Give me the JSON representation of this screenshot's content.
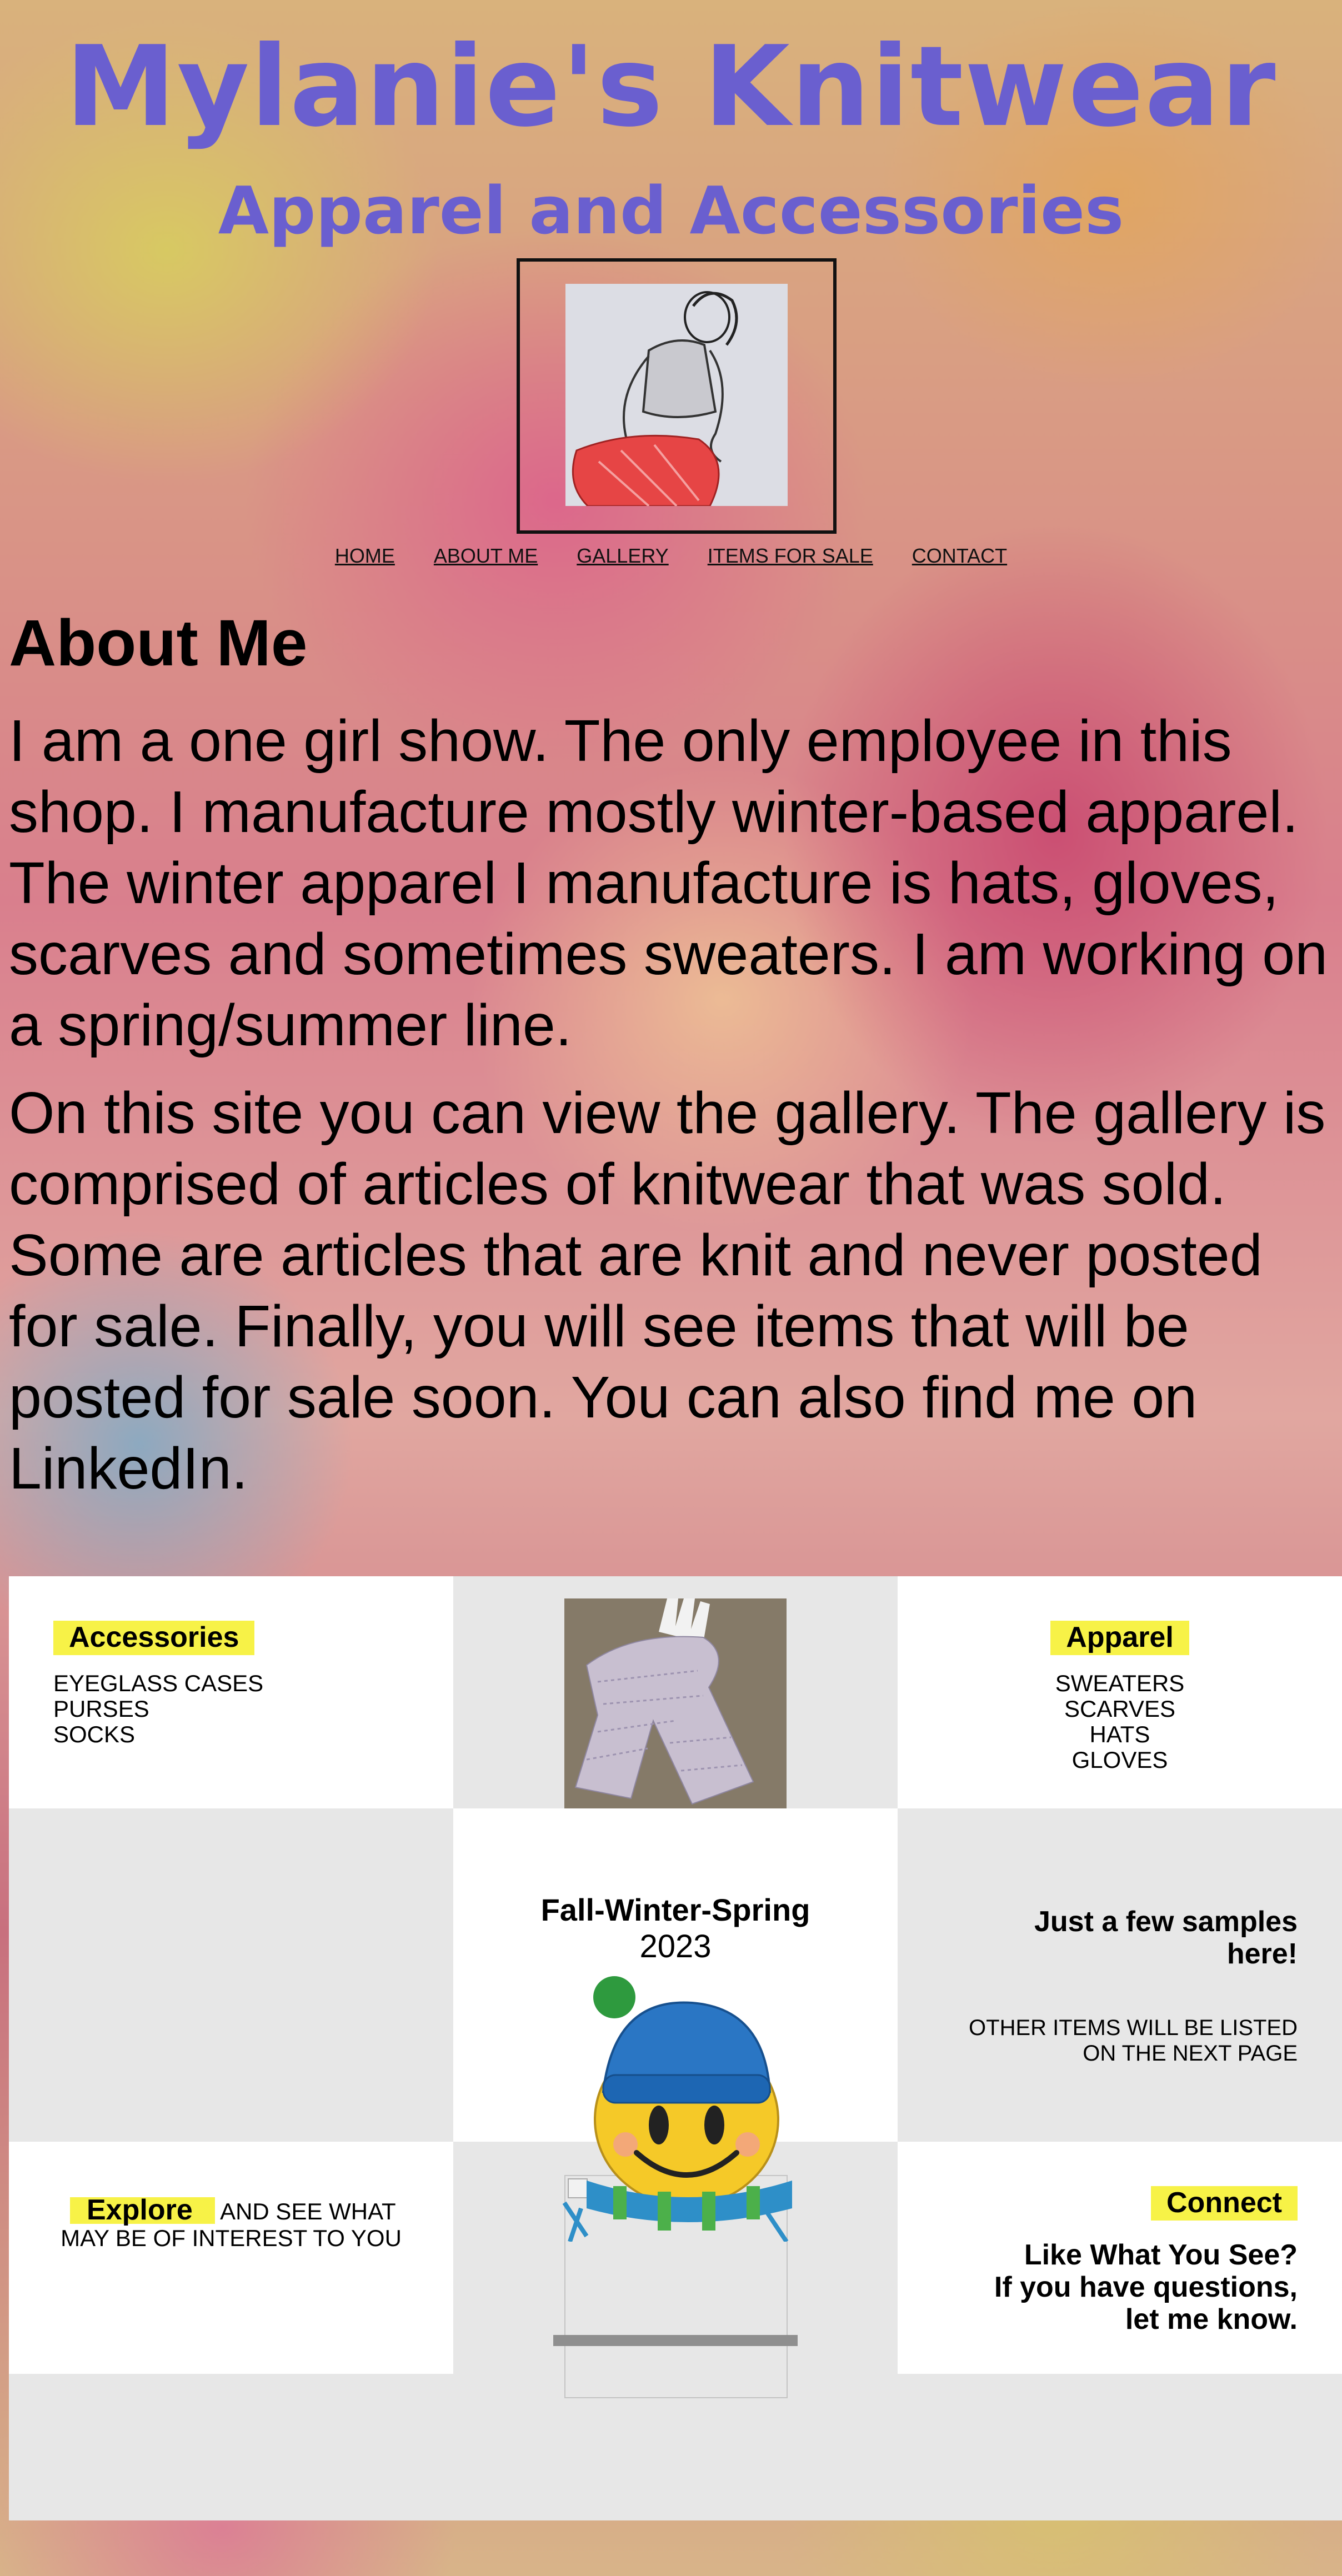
{
  "header": {
    "title": "Mylanie's Knitwear",
    "subtitle": "Apparel and Accessories"
  },
  "nav": {
    "items": [
      {
        "label": "HOME"
      },
      {
        "label": "ABOUT ME"
      },
      {
        "label": "GALLERY"
      },
      {
        "label": "ITEMS FOR SALE"
      },
      {
        "label": "CONTACT"
      }
    ]
  },
  "about": {
    "heading": "About Me",
    "paragraph1": "I am a one girl show. The only employee in this shop. I manufacture mostly winter-based apparel. The winter apparel I manufacture is hats, gloves, scarves and sometimes sweaters. I am working on a spring/summer line.",
    "paragraph2": "On this site you can view the gallery. The gallery is comprised of articles of knitwear that was sold. Some are articles that are knit and never posted for sale. Finally, you will see items that will be posted for sale soon. You can also find me on LinkedIn."
  },
  "grid": {
    "accessories": {
      "heading": "Accessories",
      "items": [
        "EYEGLASS CASES",
        "PURSES",
        "SOCKS"
      ]
    },
    "apparel": {
      "heading": "Apparel",
      "items": [
        "SWEATERS",
        "SCARVES",
        "HATS",
        "GLOVES"
      ]
    },
    "season": {
      "title": "Fall-Winter-Spring",
      "year": "2023"
    },
    "samples": {
      "heading_line1": "Just a few samples",
      "heading_line2": "here!",
      "note_line1": "OTHER ITEMS WILL BE LISTED",
      "note_line2": "ON THE NEXT PAGE"
    },
    "explore": {
      "heading": "Explore",
      "text_line1": " AND SEE WHAT",
      "text_line2": "MAY BE OF INTEREST TO YOU"
    },
    "connect": {
      "heading": "Connect",
      "line1": "Like What You See?",
      "line2": "If you have questions,",
      "line3": "let me know."
    }
  },
  "colors": {
    "title": "#6a5fcf",
    "highlight": "#f7f247",
    "grid_gray": "#e7e7e7"
  }
}
